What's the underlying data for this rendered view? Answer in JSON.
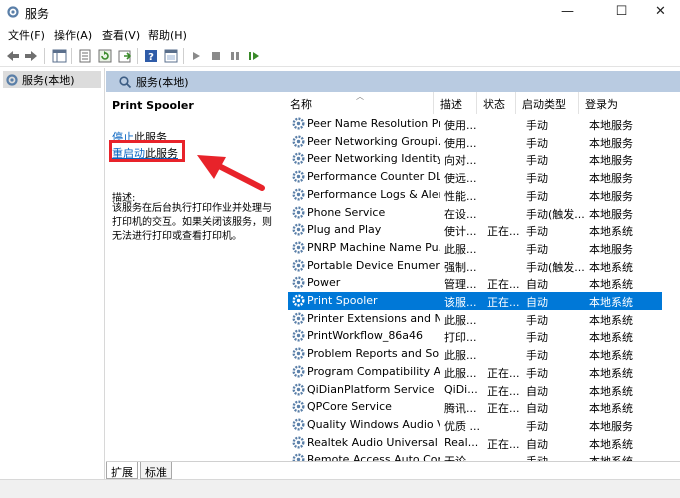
{
  "window": {
    "title": "服务",
    "minimize": "—",
    "maximize": "☐",
    "close": "✕"
  },
  "menu": [
    "文件(F)",
    "操作(A)",
    "查看(V)",
    "帮助(H)"
  ],
  "toolbar_icons": [
    "back-icon",
    "forward-icon",
    "show-hide-tree-icon",
    "export-list-icon",
    "refresh-icon",
    "properties-icon",
    "help-icon",
    "view-icon",
    "start-service-icon",
    "stop-service-icon",
    "pause-service-icon",
    "restart-service-icon"
  ],
  "left_pane": {
    "item": "服务(本地)"
  },
  "header": {
    "title": "服务(本地)"
  },
  "detail": {
    "service_name": "Print Spooler",
    "stop_link": "停止",
    "stop_suffix": "此服务",
    "restart_link": "重启动",
    "restart_suffix": "此服务",
    "desc_label": "描述:",
    "desc_text": "该服务在后台执行打印作业并处理与打印机的交互。如果关闭该服务，则无法进行打印或查看打印机。"
  },
  "columns": [
    "名称",
    "描述",
    "状态",
    "启动类型",
    "登录为"
  ],
  "services": [
    {
      "name": "Peer Name Resolution Pr...",
      "desc": "使用...",
      "status": "",
      "startup": "手动",
      "logon": "本地服务"
    },
    {
      "name": "Peer Networking Groupi...",
      "desc": "使用...",
      "status": "",
      "startup": "手动",
      "logon": "本地服务"
    },
    {
      "name": "Peer Networking Identity...",
      "desc": "向对...",
      "status": "",
      "startup": "手动",
      "logon": "本地服务"
    },
    {
      "name": "Performance Counter DL...",
      "desc": "使远...",
      "status": "",
      "startup": "手动",
      "logon": "本地服务"
    },
    {
      "name": "Performance Logs & Aler...",
      "desc": "性能...",
      "status": "",
      "startup": "手动",
      "logon": "本地服务"
    },
    {
      "name": "Phone Service",
      "desc": "在设...",
      "status": "",
      "startup": "手动(触发...",
      "logon": "本地服务"
    },
    {
      "name": "Plug and Play",
      "desc": "使计...",
      "status": "正在...",
      "startup": "手动",
      "logon": "本地系统"
    },
    {
      "name": "PNRP Machine Name Pu...",
      "desc": "此服...",
      "status": "",
      "startup": "手动",
      "logon": "本地服务"
    },
    {
      "name": "Portable Device Enumera...",
      "desc": "强制...",
      "status": "",
      "startup": "手动(触发...",
      "logon": "本地系统"
    },
    {
      "name": "Power",
      "desc": "管理...",
      "status": "正在...",
      "startup": "自动",
      "logon": "本地系统"
    },
    {
      "name": "Print Spooler",
      "desc": "该服...",
      "status": "正在...",
      "startup": "自动",
      "logon": "本地系统"
    },
    {
      "name": "Printer Extensions and N...",
      "desc": "此服...",
      "status": "",
      "startup": "手动",
      "logon": "本地系统"
    },
    {
      "name": "PrintWorkflow_86a46",
      "desc": "打印...",
      "status": "",
      "startup": "手动",
      "logon": "本地系统"
    },
    {
      "name": "Problem Reports and Sol...",
      "desc": "此服...",
      "status": "",
      "startup": "手动",
      "logon": "本地系统"
    },
    {
      "name": "Program Compatibility A...",
      "desc": "此服...",
      "status": "正在...",
      "startup": "手动",
      "logon": "本地系统"
    },
    {
      "name": "QiDianPlatform Service",
      "desc": "QiDi...",
      "status": "正在...",
      "startup": "自动",
      "logon": "本地系统"
    },
    {
      "name": "QPCore Service",
      "desc": "腾讯...",
      "status": "正在...",
      "startup": "自动",
      "logon": "本地系统"
    },
    {
      "name": "Quality Windows Audio V...",
      "desc": "优质 ...",
      "status": "",
      "startup": "手动",
      "logon": "本地服务"
    },
    {
      "name": "Realtek Audio Universal ...",
      "desc": "Real...",
      "status": "正在...",
      "startup": "自动",
      "logon": "本地系统"
    },
    {
      "name": "Remote Access Auto Con...",
      "desc": "无论...",
      "status": "",
      "startup": "手动",
      "logon": "本地系统"
    }
  ],
  "selected_index": 10,
  "tabs": [
    "扩展",
    "标准"
  ],
  "colors": {
    "accent": "#0078d7",
    "header": "#b9cbe1",
    "highlight_box": "#e8232a",
    "link": "#0563c1"
  }
}
